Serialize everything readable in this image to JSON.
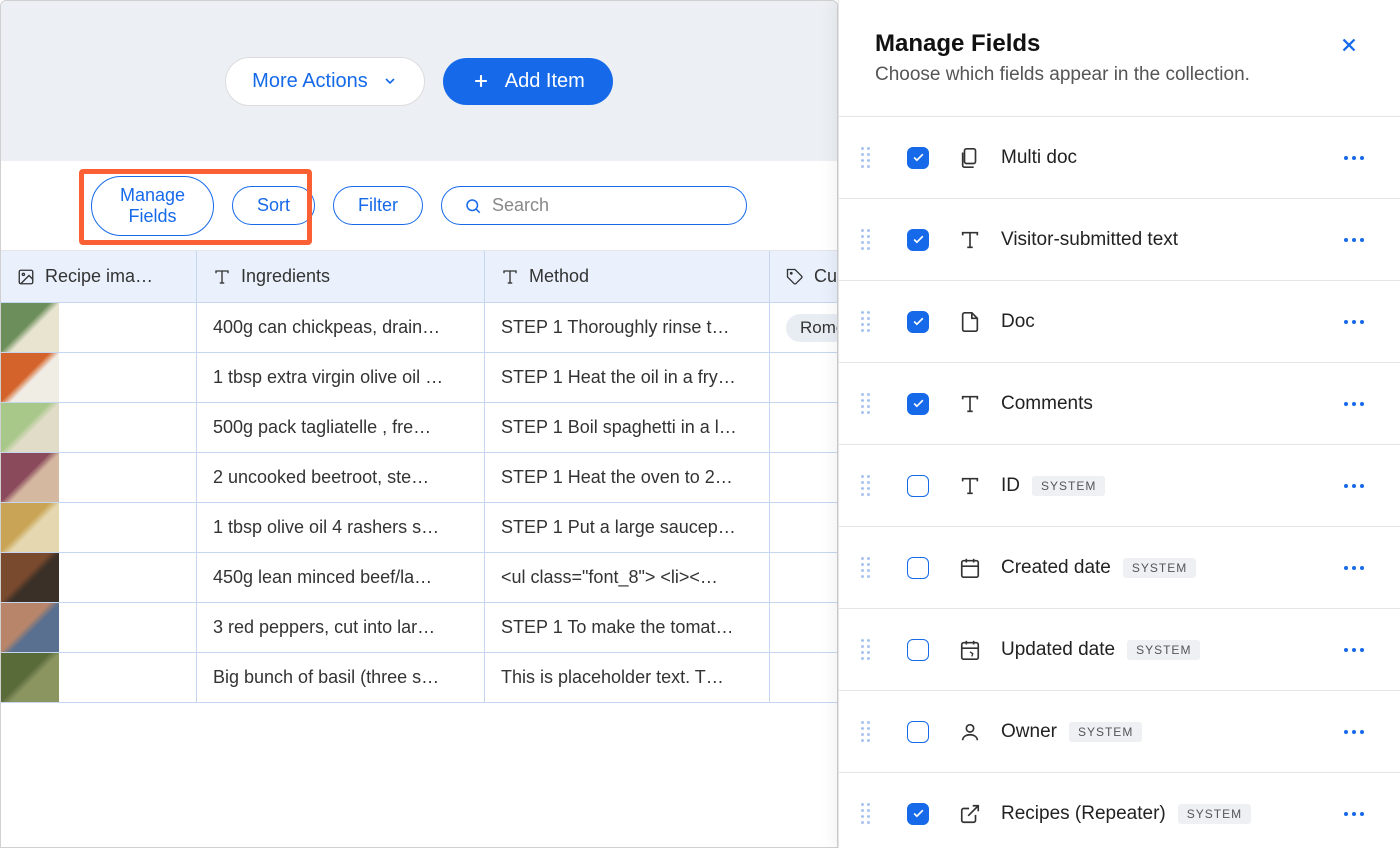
{
  "topbar": {
    "more_actions": "More Actions",
    "add_item": "Add Item"
  },
  "toolbar": {
    "manage_fields": "Manage Fields",
    "sort": "Sort",
    "filter": "Filter",
    "search_placeholder": "Search"
  },
  "columns": {
    "image": "Recipe ima…",
    "ingredients": "Ingredients",
    "method": "Method",
    "cuisine": "Cu"
  },
  "rows": [
    {
      "thumb_colors": [
        "#6b8e5a",
        "#e8e4d0"
      ],
      "ingredients": "400g can chickpeas, drain…",
      "method": "STEP 1 Thoroughly rinse t…",
      "cuisine": "Rome"
    },
    {
      "thumb_colors": [
        "#d4632b",
        "#f0ede5"
      ],
      "ingredients": "1 tbsp extra virgin olive oil …",
      "method": "STEP 1 Heat the oil in a fry…",
      "cuisine": ""
    },
    {
      "thumb_colors": [
        "#a8c88a",
        "#e0dcc8"
      ],
      "ingredients": "500g pack tagliatelle , fre…",
      "method": "STEP 1 Boil spaghetti in a l…",
      "cuisine": ""
    },
    {
      "thumb_colors": [
        "#8b4a5c",
        "#d4b8a0"
      ],
      "ingredients": "2 uncooked beetroot, ste…",
      "method": "STEP 1 Heat the oven to 2…",
      "cuisine": ""
    },
    {
      "thumb_colors": [
        "#c9a456",
        "#e5d8b0"
      ],
      "ingredients": "1 tbsp olive oil 4 rashers s…",
      "method": "STEP 1 Put a large saucep…",
      "cuisine": ""
    },
    {
      "thumb_colors": [
        "#7a4a2e",
        "#3a3028"
      ],
      "ingredients": "450g lean minced beef/la…",
      "method": "<ul class=\"font_8\"> <li><…",
      "cuisine": ""
    },
    {
      "thumb_colors": [
        "#b8856a",
        "#5a7090"
      ],
      "ingredients": "3 red peppers, cut into lar…",
      "method": "STEP 1 To make the tomat…",
      "cuisine": ""
    },
    {
      "thumb_colors": [
        "#5a6b3a",
        "#8a9560"
      ],
      "ingredients": "Big bunch of basil (three s…",
      "method": "This is placeholder text. T…",
      "cuisine": ""
    }
  ],
  "panel": {
    "title": "Manage Fields",
    "subtitle": "Choose which fields appear in the collection.",
    "fields": [
      {
        "checked": true,
        "icon": "multidoc",
        "label": "Multi doc",
        "system": false
      },
      {
        "checked": true,
        "icon": "text",
        "label": "Visitor-submitted text",
        "system": false
      },
      {
        "checked": true,
        "icon": "doc",
        "label": "Doc",
        "system": false
      },
      {
        "checked": true,
        "icon": "text",
        "label": "Comments",
        "system": false
      },
      {
        "checked": false,
        "icon": "text",
        "label": "ID",
        "system": true
      },
      {
        "checked": false,
        "icon": "calendar",
        "label": "Created date",
        "system": true
      },
      {
        "checked": false,
        "icon": "calendar-r",
        "label": "Updated date",
        "system": true
      },
      {
        "checked": false,
        "icon": "person",
        "label": "Owner",
        "system": true
      },
      {
        "checked": true,
        "icon": "link",
        "label": "Recipes (Repeater)",
        "system": true
      }
    ],
    "system_label": "SYSTEM"
  }
}
